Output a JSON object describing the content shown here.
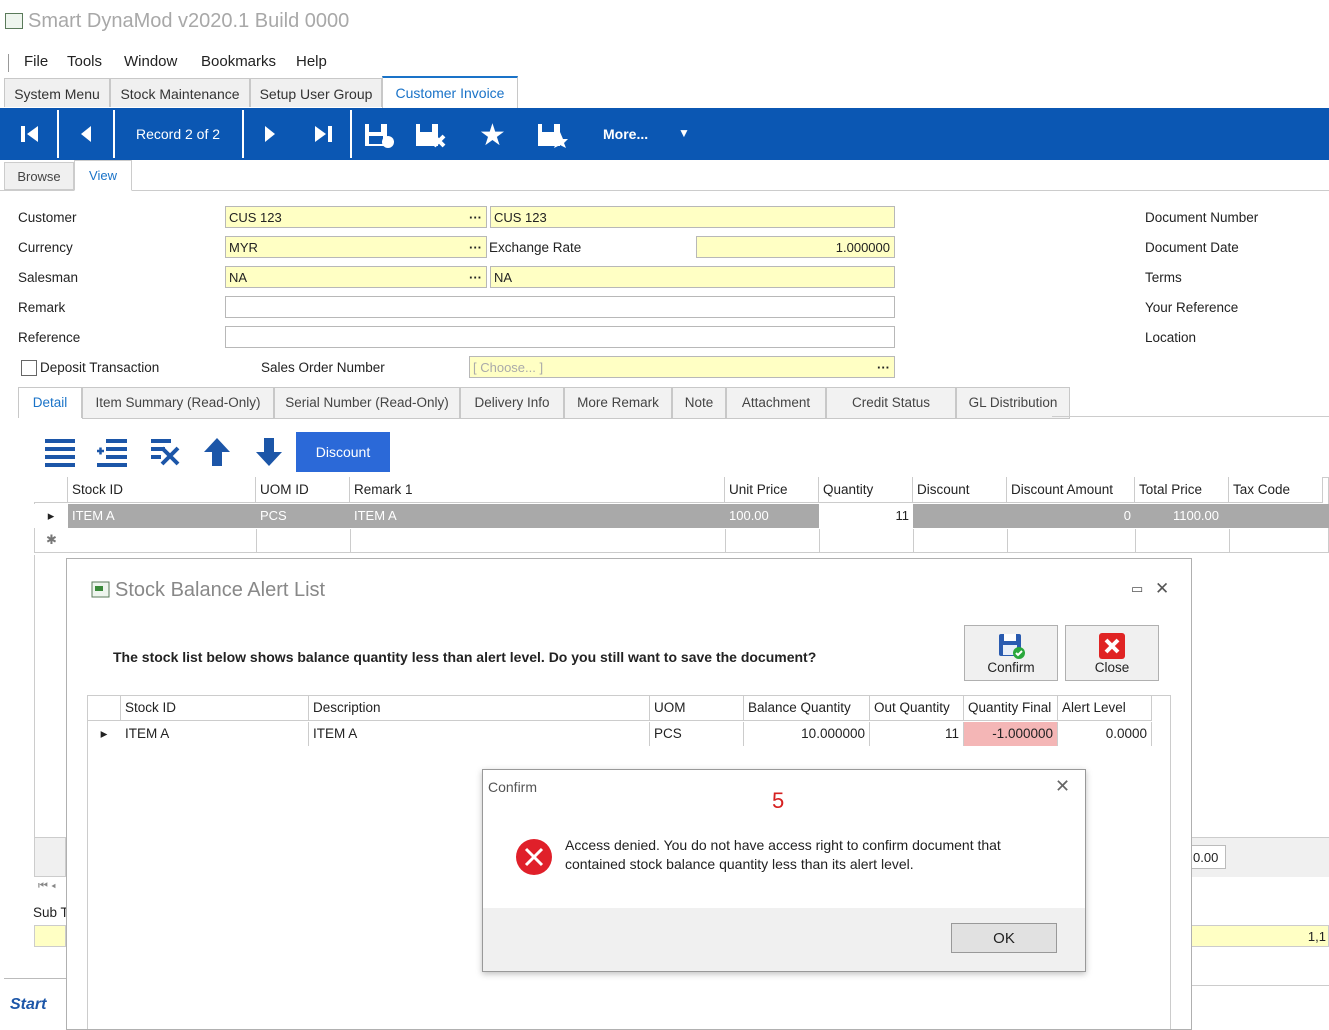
{
  "app": {
    "title": "Smart DynaMod v2020.1 Build 0000"
  },
  "menu": [
    "File",
    "Tools",
    "Window",
    "Bookmarks",
    "Help"
  ],
  "top_tabs": [
    "System Menu",
    "Stock Maintenance",
    "Setup User Group",
    "Customer Invoice"
  ],
  "toolbar": {
    "record": "Record 2 of 2",
    "more": "More..."
  },
  "sub_tabs": [
    "Browse",
    "View"
  ],
  "form": {
    "customer_label": "Customer",
    "customer_code": "CUS 123",
    "customer_name": "CUS 123",
    "currency_label": "Currency",
    "currency": "MYR",
    "exchange_rate_label": "Exchange Rate",
    "exchange_rate": "1.000000",
    "salesman_label": "Salesman",
    "salesman_code": "NA",
    "salesman_name": "NA",
    "remark_label": "Remark",
    "reference_label": "Reference",
    "deposit_label": "Deposit Transaction",
    "sales_order_label": "Sales Order Number",
    "sales_order_placeholder": "[ Choose... ]",
    "right_labels": [
      "Document Number",
      "Document Date",
      "Terms",
      "Your Reference",
      "Location"
    ]
  },
  "detail_tabs": [
    "Detail",
    "Item Summary (Read-Only)",
    "Serial Number (Read-Only)",
    "Delivery Info",
    "More Remark",
    "Note",
    "Attachment",
    "Credit Status",
    "GL Distribution"
  ],
  "detail_toolbar": {
    "discount": "Discount"
  },
  "grid": {
    "headers": [
      "Stock ID",
      "UOM ID",
      "Remark 1",
      "Unit Price",
      "Quantity",
      "Discount",
      "Discount Amount",
      "Total Price",
      "Tax Code"
    ],
    "row": [
      "ITEM A",
      "PCS",
      "ITEM A",
      "100.00",
      "11",
      "",
      "0",
      "1100.00",
      ""
    ]
  },
  "background_fragments": {
    "value_1": "0.00",
    "sub": "Sub T",
    "value_2": "1,1",
    "logo": "Start"
  },
  "alert_dialog": {
    "title": "Stock Balance Alert List",
    "message": "The stock list below shows balance quantity less than alert level. Do you still want to save the document?",
    "confirm_label": "Confirm",
    "close_label": "Close",
    "headers": [
      "Stock ID",
      "Description",
      "UOM",
      "Balance Quantity",
      "Out Quantity",
      "Quantity Final",
      "Alert Level"
    ],
    "row": [
      "ITEM A",
      "ITEM A",
      "PCS",
      "10.000000",
      "11",
      "-1.000000",
      "0.0000"
    ]
  },
  "confirm_dialog": {
    "title": "Confirm",
    "annotation": "5",
    "message_line1": "Access denied. You do not have access right to confirm document that",
    "message_line2": "contained stock balance quantity less than its alert level.",
    "ok": "OK"
  },
  "colors": {
    "toolbar": "#0b57b3",
    "field": "#ffffc4",
    "negative": "#f4b6b6",
    "selected_row": "#a9a9a9",
    "error": "#e0202a"
  }
}
